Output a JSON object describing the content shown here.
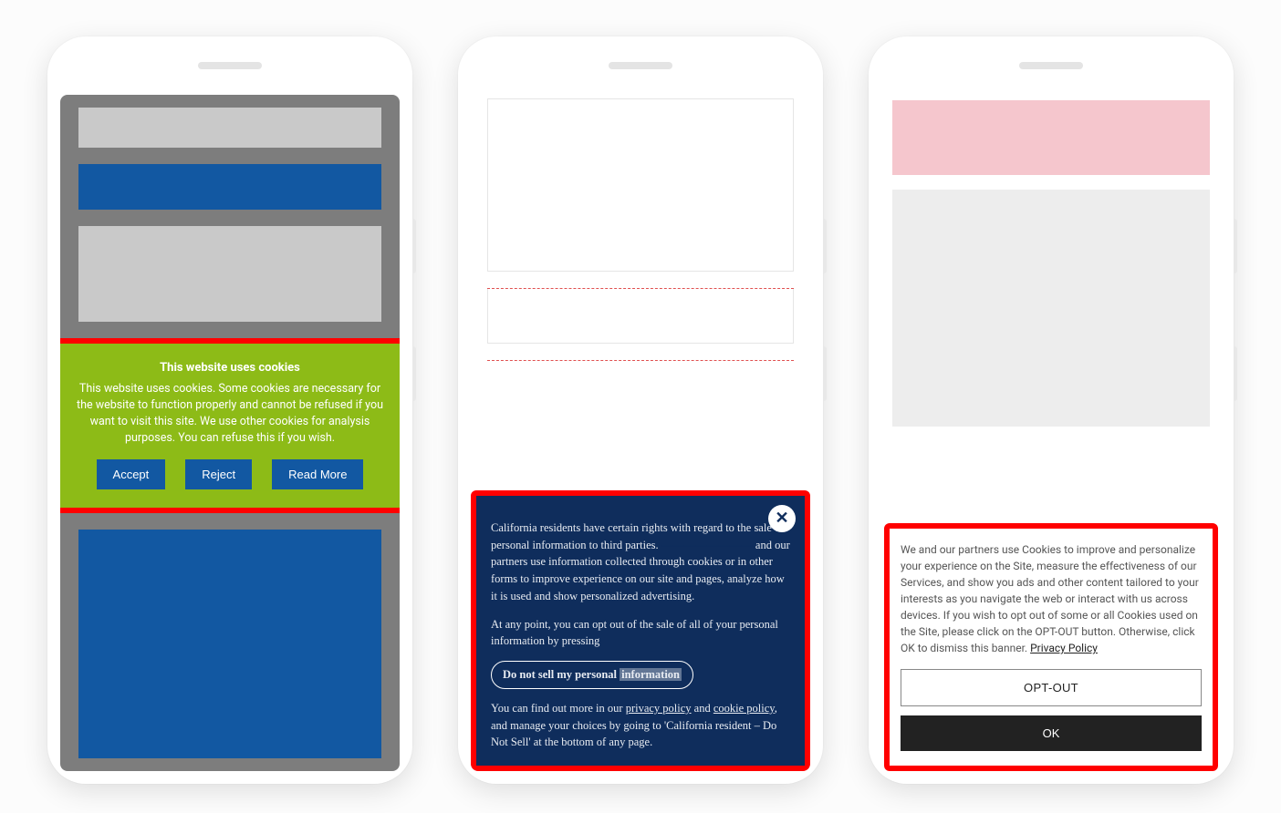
{
  "phone1": {
    "banner": {
      "title": "This website uses cookies",
      "body": "This website uses cookies. Some cookies are necessary for the website to function properly and cannot be refused if you want to visit this site. We use other cookies for analysis purposes. You can refuse this if you wish.",
      "accept": "Accept",
      "reject": "Reject",
      "read_more": "Read More"
    }
  },
  "phone2": {
    "banner": {
      "para1_a": "California residents have certain rights with regard to the sale of personal information to third parties.",
      "para1_b": " and our partners use information collected through cookies or in other forms to improve experience on our site and pages, analyze how it is used and show personalized advertising.",
      "para2": "At any point, you can opt out of the sale of all of your personal information by pressing",
      "dns_button_a": "Do not sell my personal ",
      "dns_button_b": "information",
      "para3_a": "You can find out more in our ",
      "privacy_policy_link": "privacy policy",
      "and": " and ",
      "cookie_policy_link": "cookie policy",
      "para3_b": ", and manage your choices by going to 'California resident – Do Not Sell' at the bottom of any page."
    }
  },
  "phone3": {
    "banner": {
      "body": "We and our partners use Cookies to improve and personalize your experience on the Site, measure the effectiveness of our Services, and show you ads and other content tailored to your interests as you navigate the web or interact with us across devices. If you wish to opt out of some or all Cookies used on the Site, please click on the OPT-OUT button. Otherwise, click OK to dismiss this banner. ",
      "privacy_link": "Privacy Policy",
      "opt_out": "OPT-OUT",
      "ok": "OK"
    }
  }
}
